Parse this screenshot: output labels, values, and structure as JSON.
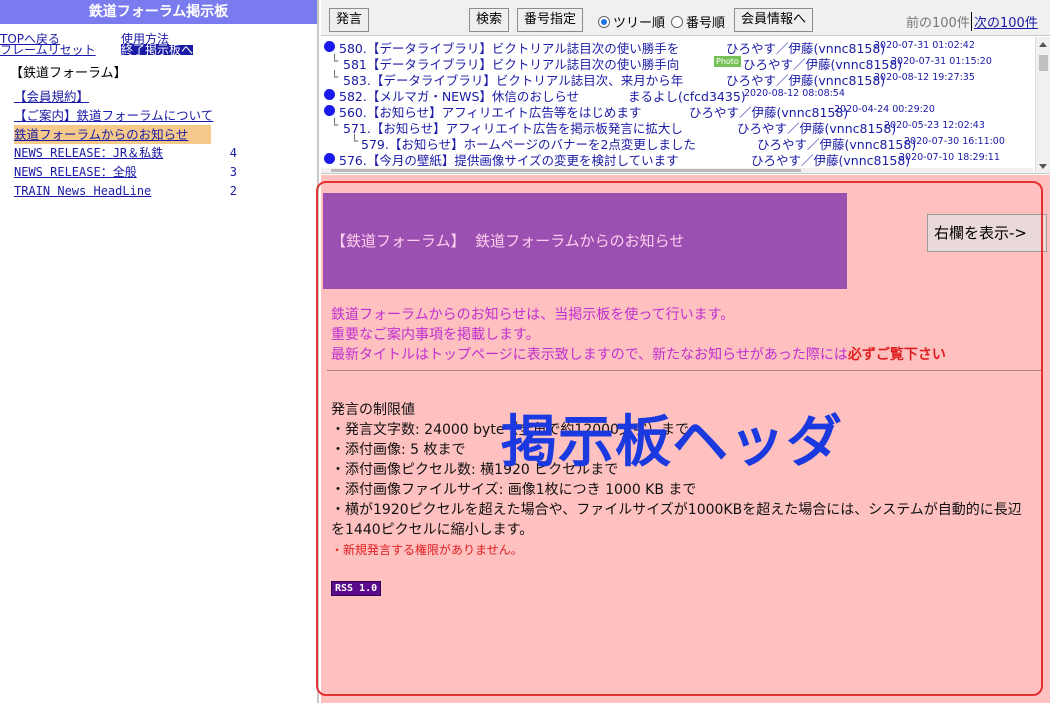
{
  "left": {
    "title": "鉄道フォーラム掲示板",
    "links": {
      "top": "TOPへ戻る",
      "usage": "使用方法",
      "reset": "フレームリセット",
      "exit": "終了掲示板へ"
    },
    "board_name": "【鉄道フォーラム】",
    "menu": [
      {
        "label": "【会員規約】",
        "count": ""
      },
      {
        "label": "【ご案内】鉄道フォーラムについて",
        "count": ""
      },
      {
        "label": "鉄道フォーラムからのお知らせ",
        "count": ""
      },
      {
        "label": "NEWS RELEASE：JR＆私鉄",
        "count": "4"
      },
      {
        "label": "NEWS RELEASE：全般",
        "count": "3"
      },
      {
        "label": "TRAIN News HeadLine",
        "count": "2"
      }
    ]
  },
  "toolbar": {
    "post": "発言",
    "search": "検索",
    "number_select": "番号指定",
    "tree_order": "ツリー順",
    "number_order": "番号順",
    "member_info": "会員情報へ",
    "prev": "前の100件",
    "next": "次の100件"
  },
  "threads": [
    {
      "title": "580.【データライブラリ】ビクトリアル誌目次の使い勝手を",
      "author": "ひろやす／伊藤(vnnc8158)",
      "date": "2020-07-31 01:02:42",
      "photo": ""
    },
    {
      "title": "581【データライブラリ】ビクトリアル誌目次の使い勝手向",
      "author": "ひろやす／伊藤(vnnc8158)",
      "date": "2020-07-31 01:15:20",
      "photo": "Photo"
    },
    {
      "title": "583.【データライブラリ】ビクトリアル誌目次、来月から年",
      "author": "ひろやす／伊藤(vnnc8158)",
      "date": "2020-08-12 19:27:35",
      "photo": ""
    },
    {
      "title": "582.【メルマガ・NEWS】休信のおしらせ",
      "author": "まるよし(cfcd3435)",
      "date": "2020-08-12 08:08:54",
      "photo": ""
    },
    {
      "title": "560.【お知らせ】アフィリエイト広告等をはじめます",
      "author": "ひろやす／伊藤(vnnc8158)",
      "date": "2020-04-24 00:29:20",
      "photo": ""
    },
    {
      "title": "571.【お知らせ】アフィリエイト広告を掲示板発言に拡大し",
      "author": "ひろやす／伊藤(vnnc8158)",
      "date": "2020-05-23 12:02:43",
      "photo": ""
    },
    {
      "title": "579.【お知らせ】ホームページのバナーを2点変更しました",
      "author": "ひろやす／伊藤(vnnc8158)",
      "date": "2020-07-30 16:11:00",
      "photo": ""
    },
    {
      "title": "576.【今月の壁紙】提供画像サイズの変更を検討しています",
      "author": "ひろやす／伊藤(vnnc8158)",
      "date": "2020-07-10 18:29:11",
      "photo": ""
    }
  ],
  "panel": {
    "header_board": "【鉄道フォーラム】",
    "header_title": "鉄道フォーラムからのお知らせ",
    "toggle_button": "右欄を表示->",
    "intro": [
      "鉄道フォーラムからのお知らせは、当掲示板を使って行います。",
      "重要なご案内事項を掲載します。",
      "最新タイトルはトップページに表示致しますので、新たなお知らせがあった際には"
    ],
    "intro_strong": "必ずご覧下さい",
    "limits": [
      "発言の制限値",
      "・発言文字数: 24000 byte（全角で約12000文字）まで",
      "・添付画像: 5 枚まで",
      "・添付画像ピクセル数: 横1920 ピクセルまで",
      "・添付画像ファイルサイズ: 画像1枚につき 1000 KB まで",
      "・横が1920ピクセルを超えた場合や、ファイルサイズが1000KBを超えた場合には、システムが自動的に長辺",
      "を1440ピクセルに縮小します。"
    ],
    "no_post": "・新規発言する権限がありません。",
    "rss": "RSS 1.0",
    "overlay_label": "掲示板ヘッダ"
  }
}
